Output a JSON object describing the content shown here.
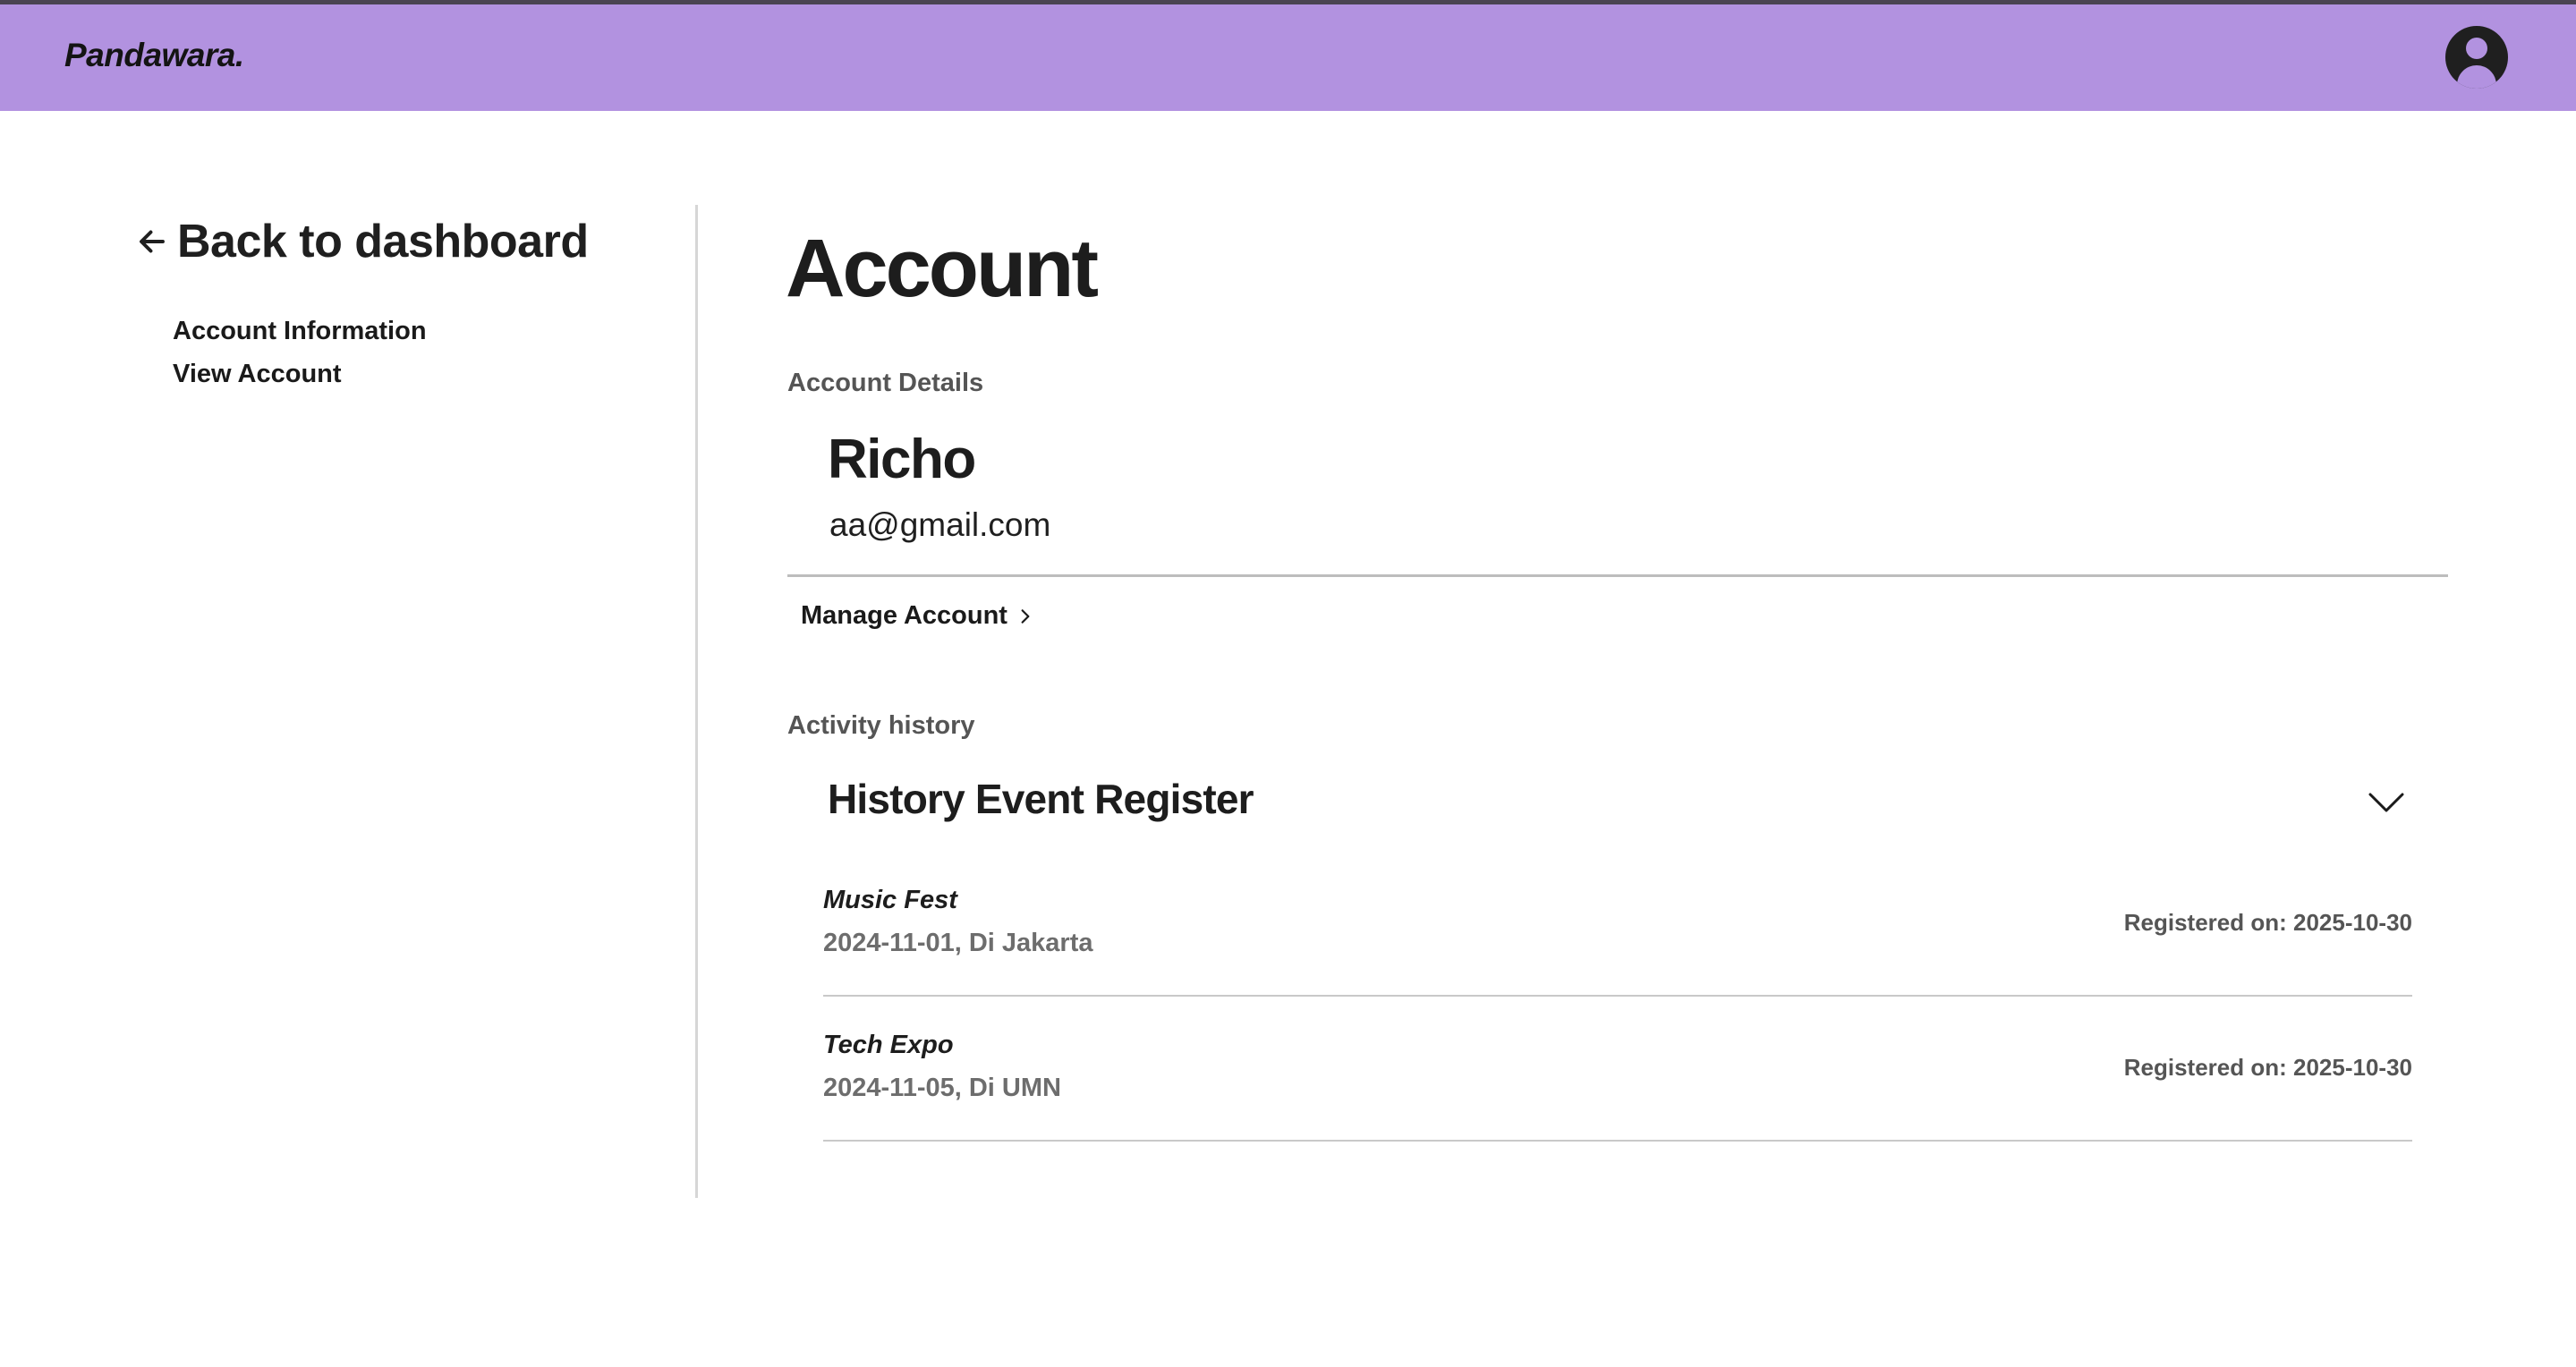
{
  "navbar": {
    "brand": "Pandawara.",
    "profile_icon": "user-circle-icon",
    "color": "#b292e0"
  },
  "sidebar": {
    "back_label": "Back to dashboard",
    "back_icon": "arrow-left-icon",
    "links": [
      {
        "label": "Account Information"
      },
      {
        "label": "View Account"
      }
    ]
  },
  "main": {
    "title": "Account",
    "account_details_label": "Account Details",
    "user": {
      "name": "Richo",
      "email": "aa@gmail.com"
    },
    "manage_account_label": "Manage Account",
    "manage_icon": "chevron-right-icon",
    "activity_label": "Activity history",
    "history": {
      "title": "History Event Register",
      "toggle_icon": "chevron-down-icon",
      "events": [
        {
          "name": "Music Fest",
          "meta": "2024-11-01, Di Jakarta",
          "registered": "Registered on: 2025-10-30"
        },
        {
          "name": "Tech Expo",
          "meta": "2024-11-05, Di UMN",
          "registered": "Registered on: 2025-10-30"
        }
      ]
    }
  }
}
